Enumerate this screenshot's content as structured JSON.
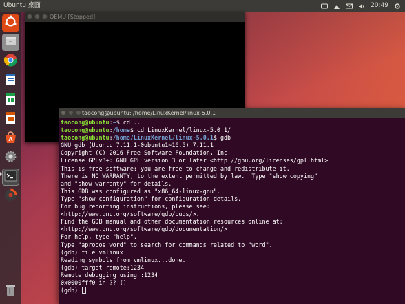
{
  "topbar": {
    "title": "Ubuntu 桌面",
    "clock": "20:49"
  },
  "qemu_window": {
    "title": "QEMU [Stopped]"
  },
  "terminal_window": {
    "title": "taocong@ubuntu: /home/LinuxKernel/linux-5.0.1"
  },
  "terminal": {
    "prompt_user": "taocong@ubuntu",
    "lines": [
      {
        "type": "prompt",
        "path": "~",
        "cmd": " cd .."
      },
      {
        "type": "prompt",
        "path": "/home",
        "cmd": " cd LinuxKernel/linux-5.0.1/"
      },
      {
        "type": "prompt",
        "path": "/home/LinuxKernel/linux-5.0.1",
        "cmd": " gdb"
      },
      {
        "type": "text",
        "text": "GNU gdb (Ubuntu 7.11.1-0ubuntu1~16.5) 7.11.1"
      },
      {
        "type": "text",
        "text": "Copyright (C) 2016 Free Software Foundation, Inc."
      },
      {
        "type": "text",
        "text": "License GPLv3+: GNU GPL version 3 or later <http://gnu.org/licenses/gpl.html>"
      },
      {
        "type": "text",
        "text": "This is free software: you are free to change and redistribute it."
      },
      {
        "type": "text",
        "text": "There is NO WARRANTY, to the extent permitted by law.  Type \"show copying\""
      },
      {
        "type": "text",
        "text": "and \"show warranty\" for details."
      },
      {
        "type": "text",
        "text": "This GDB was configured as \"x86_64-linux-gnu\"."
      },
      {
        "type": "text",
        "text": "Type \"show configuration\" for configuration details."
      },
      {
        "type": "text",
        "text": "For bug reporting instructions, please see:"
      },
      {
        "type": "text",
        "text": "<http://www.gnu.org/software/gdb/bugs/>."
      },
      {
        "type": "text",
        "text": "Find the GDB manual and other documentation resources online at:"
      },
      {
        "type": "text",
        "text": "<http://www.gnu.org/software/gdb/documentation/>."
      },
      {
        "type": "text",
        "text": "For help, type \"help\"."
      },
      {
        "type": "text",
        "text": "Type \"apropos word\" to search for commands related to \"word\"."
      },
      {
        "type": "text",
        "text": "(gdb) file vmlinux"
      },
      {
        "type": "text",
        "text": "Reading symbols from vmlinux...done."
      },
      {
        "type": "text",
        "text": "(gdb) target remote:1234"
      },
      {
        "type": "text",
        "text": "Remote debugging using :1234"
      },
      {
        "type": "text",
        "text": "0x0000fff0 in ?? ()"
      },
      {
        "type": "cursor",
        "text": "(gdb) "
      }
    ]
  },
  "launcher": {
    "items": [
      {
        "icon": "ubuntu-logo-icon",
        "color": "#dd4814"
      },
      {
        "icon": "files-icon",
        "color": "#8f8f8f"
      },
      {
        "icon": "chrome-icon",
        "color": "#4285f4"
      },
      {
        "icon": "writer-icon",
        "color": "#2a6ebb"
      },
      {
        "icon": "calc-icon",
        "color": "#1d9e48"
      },
      {
        "icon": "impress-icon",
        "color": "#d45500"
      },
      {
        "icon": "software-center-icon",
        "color": "#e95420"
      },
      {
        "icon": "settings-icon",
        "color": "#7d7d7d"
      },
      {
        "icon": "terminal-icon",
        "color": "#2c2c2c"
      },
      {
        "icon": "update-icon",
        "color": "#c0392b"
      },
      {
        "icon": "trash-icon",
        "color": "#9a9a9a"
      }
    ]
  },
  "colors": {
    "terminal_bg": "#300a24",
    "prompt_user": "#8ae234",
    "prompt_path": "#729fcf",
    "panel": "#3c3b37"
  }
}
